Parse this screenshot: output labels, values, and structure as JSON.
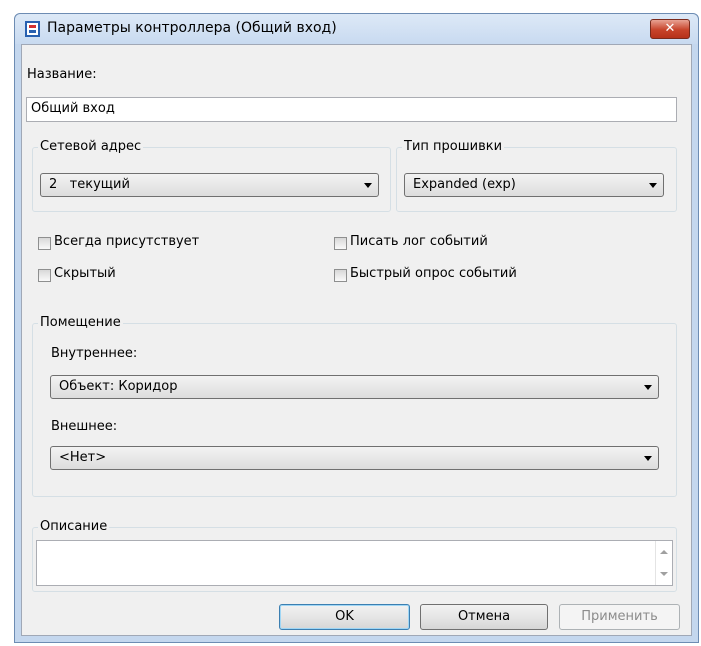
{
  "window": {
    "title": "Параметры контроллера (Общий вход)",
    "close_glyph": "✕"
  },
  "name_section": {
    "label": "Название:",
    "value": "Общий вход"
  },
  "network_address": {
    "group_title": "Сетевой адрес",
    "selected": "2   текущий"
  },
  "firmware": {
    "group_title": "Тип прошивки",
    "selected": "Expanded (exp)"
  },
  "checkboxes": {
    "always_present": {
      "label": "Всегда присутствует",
      "checked": false
    },
    "hidden": {
      "label": "Скрытый",
      "checked": false
    },
    "write_log": {
      "label": "Писать лог событий",
      "checked": false
    },
    "fast_poll": {
      "label": "Быстрый опрос событий",
      "checked": false
    }
  },
  "room": {
    "group_title": "Помещение",
    "inner_label": "Внутреннее:",
    "inner_selected": "Объект: Коридор",
    "outer_label": "Внешнее:",
    "outer_selected": "<Нет>"
  },
  "description": {
    "group_title": "Описание",
    "value": ""
  },
  "buttons": {
    "ok": "OK",
    "cancel": "Отмена",
    "apply": "Применить"
  },
  "icons": {
    "app": "app-icon",
    "close": "close-icon",
    "dropdown": "chevron-down-icon"
  }
}
